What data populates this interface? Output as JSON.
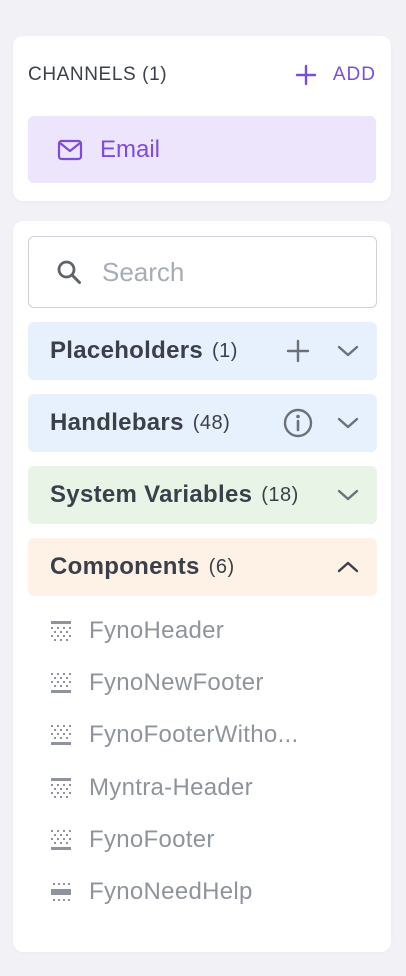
{
  "channels": {
    "title": "CHANNELS (1)",
    "add_label": "ADD",
    "items": [
      {
        "label": "Email",
        "icon": "mail-icon"
      }
    ]
  },
  "search": {
    "placeholder": "Search",
    "value": ""
  },
  "sections": [
    {
      "title": "Placeholders",
      "count": "(1)",
      "action_icon": "plus-icon",
      "expanded": false,
      "color": "#e6f1fd"
    },
    {
      "title": "Handlebars",
      "count": "(48)",
      "action_icon": "info-icon",
      "expanded": false,
      "color": "#e6f1fd"
    },
    {
      "title": "System Variables",
      "count": "(18)",
      "expanded": false,
      "color": "#e8f5e6"
    },
    {
      "title": "Components",
      "count": "(6)",
      "expanded": true,
      "color": "#fdf2e5"
    }
  ],
  "components": [
    {
      "label": "FynoHeader",
      "icon": "header-layout-icon"
    },
    {
      "label": "FynoNewFooter",
      "icon": "footer-layout-icon"
    },
    {
      "label": "FynoFooterWitho...",
      "icon": "footer-layout-icon"
    },
    {
      "label": "Myntra-Header",
      "icon": "header-layout-icon"
    },
    {
      "label": "FynoFooter",
      "icon": "footer-layout-icon"
    },
    {
      "label": "FynoNeedHelp",
      "icon": "content-block-icon"
    }
  ],
  "colors": {
    "accent": "#7c4ddb",
    "text": "#3b3f4a",
    "muted": "#8f949c"
  }
}
